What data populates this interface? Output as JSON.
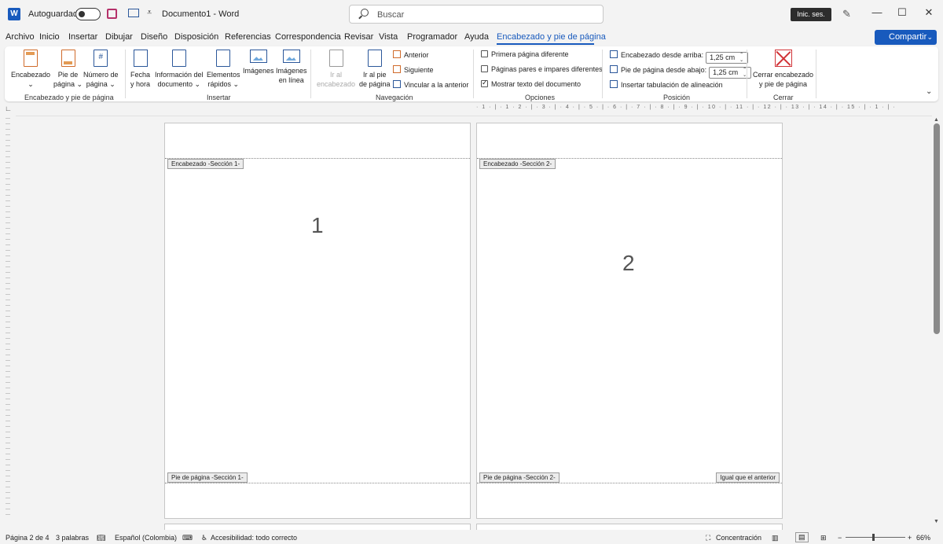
{
  "titlebar": {
    "app_icon": "W",
    "autosave_label": "Autoguardado",
    "doc_title": "Documento1  -  Word",
    "search_placeholder": "Buscar",
    "signin_label": "Inic. ses.",
    "minimize": "—",
    "maximize": "☐",
    "close": "✕"
  },
  "menu": {
    "tabs": [
      "Archivo",
      "Inicio",
      "Insertar",
      "Dibujar",
      "Diseño",
      "Disposición",
      "Referencias",
      "Correspondencia",
      "Revisar",
      "Vista",
      "Programador",
      "Ayuda",
      "Encabezado y pie de página"
    ],
    "active_tab": "Encabezado y pie de página",
    "share_label": "Compartir"
  },
  "ribbon": {
    "g1": {
      "b1": "Encabezado",
      "b2a": "Pie de",
      "b2b": "página",
      "b3a": "Número de",
      "b3b": "página",
      "label": "Encabezado y pie de página"
    },
    "g2": {
      "b1a": "Fecha",
      "b1b": "y hora",
      "b2a": "Información del",
      "b2b": "documento",
      "b3a": "Elementos",
      "b3b": "rápidos",
      "b4": "Imágenes",
      "b5a": "Imágenes",
      "b5b": "en línea",
      "label": "Insertar"
    },
    "g3": {
      "b1a": "Ir al",
      "b1b": "encabezado",
      "b2a": "Ir al pie",
      "b2b": "de página",
      "prev": "Anterior",
      "next": "Siguiente",
      "link": "Vincular a la anterior",
      "label": "Navegación"
    },
    "g4": {
      "o1": "Primera página diferente",
      "o2": "Páginas pares e impares diferentes",
      "o3": "Mostrar texto del documento",
      "label": "Opciones"
    },
    "g5": {
      "r1": "Encabezado desde arriba:",
      "v1": "1,25 cm",
      "r2": "Pie de página desde abajo:",
      "v2": "1,25 cm",
      "r3": "Insertar tabulación de alineación",
      "label": "Posición"
    },
    "g6": {
      "b1a": "Cerrar encabezado",
      "b1b": "y pie de página",
      "label": "Cerrar"
    }
  },
  "ruler": {
    "scale": "· 1 · | · 1 · 2 · | · 3 · | · 4 · | · 5 · | · 6 · | · 7 · | · 8 · | · 9 · | · 10 · | · 11 · | · 12 · | · 13 · | · 14 · | · 15 · | · 1 · | ·"
  },
  "pages": [
    {
      "number": "1",
      "header_tag": "Encabezado -Sección 1-",
      "footer_tag": "Pie de página -Sección 1-"
    },
    {
      "number": "2",
      "header_tag": "Encabezado -Sección 2-",
      "footer_tag": "Pie de página -Sección 2-",
      "same_as_previous": "Igual que el anterior"
    }
  ],
  "status": {
    "page": "Página 2 de 4",
    "words": "3 palabras",
    "language": "Español (Colombia)",
    "accessibility": "Accesibilidad: todo correcto",
    "focus": "Concentración",
    "zoom_minus": "−",
    "zoom_plus": "+",
    "zoom": "66%"
  }
}
